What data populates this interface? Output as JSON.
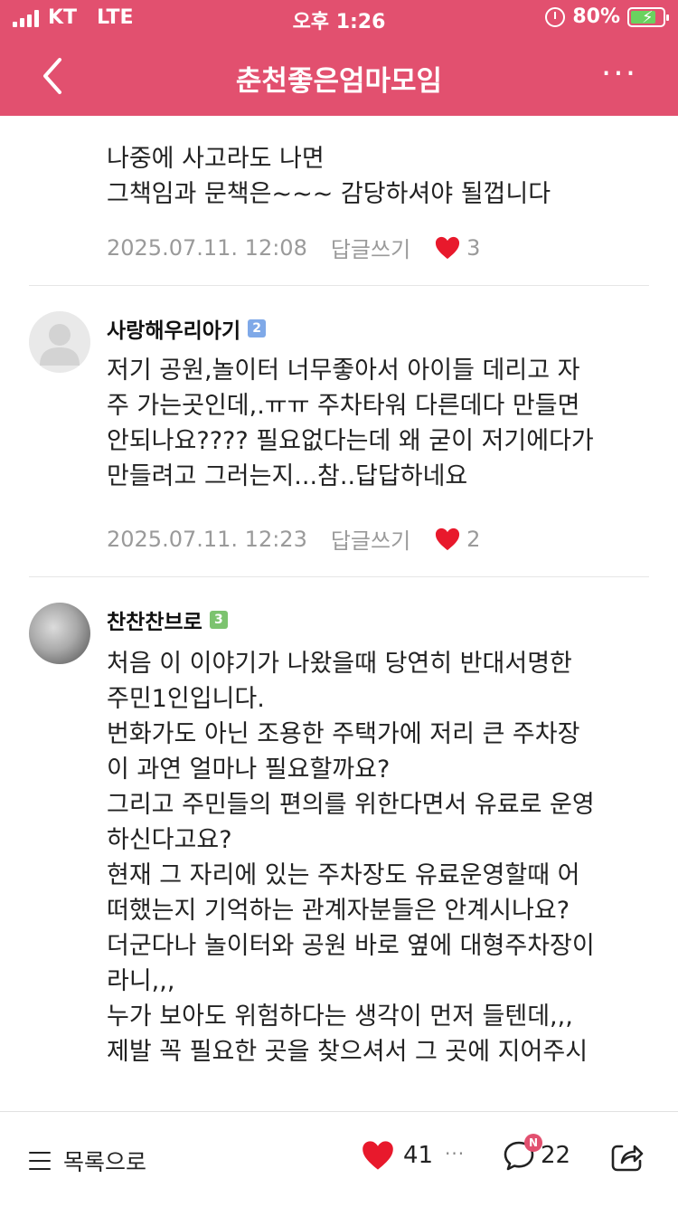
{
  "status_bar": {
    "carrier": "KT",
    "network": "LTE",
    "time": "오후 1:26",
    "battery": "80%"
  },
  "header": {
    "title": "춘천좋은엄마모임"
  },
  "comments": [
    {
      "author": "",
      "level": "",
      "text_lines": [
        "나중에 사고라도 나면",
        "그책임과 문책은~~~ 감당하셔야 될껍니다"
      ],
      "date": "2025.07.11. 12:08",
      "reply_label": "답글쓰기",
      "likes": "3"
    },
    {
      "author": "사랑해우리아기",
      "level": "2",
      "text_lines": [
        "저기 공원,놀이터 너무좋아서 아이들 데리고 자",
        "주 가는곳인데,.ㅠㅠ 주차타워 다른데다 만들면",
        "안되나요???? 필요없다는데 왜 굳이 저기에다가",
        "만들려고 그러는지...참..답답하네요"
      ],
      "date": "2025.07.11. 12:23",
      "reply_label": "답글쓰기",
      "likes": "2"
    },
    {
      "author": "찬찬찬브로",
      "level": "3",
      "text_lines": [
        "처음 이 이야기가 나왔을때 당연히 반대서명한",
        "주민1인입니다.",
        "번화가도 아닌 조용한 주택가에 저리 큰 주차장",
        "이 과연 얼마나 필요할까요?",
        "그리고 주민들의 편의를 위한다면서 유료로 운영",
        "하신다고요?",
        "현재 그 자리에 있는 주차장도 유료운영할때 어",
        "떠했는지 기억하는 관계자분들은 안계시나요?",
        "더군다나 놀이터와 공원 바로 옆에 대형주차장이",
        "라니,,,",
        "누가 보아도 위험하다는 생각이 먼저 들텐데,,,",
        "제발 꼭 필요한 곳을 찾으셔서 그 곳에 지어주시"
      ]
    }
  ],
  "bottom_bar": {
    "list_label": "목록으로",
    "likes": "41",
    "more": "···",
    "comments": "22",
    "new_badge": "N"
  },
  "colors": {
    "accent": "#e2506f",
    "heart": "#e8192c",
    "meta_gray": "#9a9a9a"
  }
}
